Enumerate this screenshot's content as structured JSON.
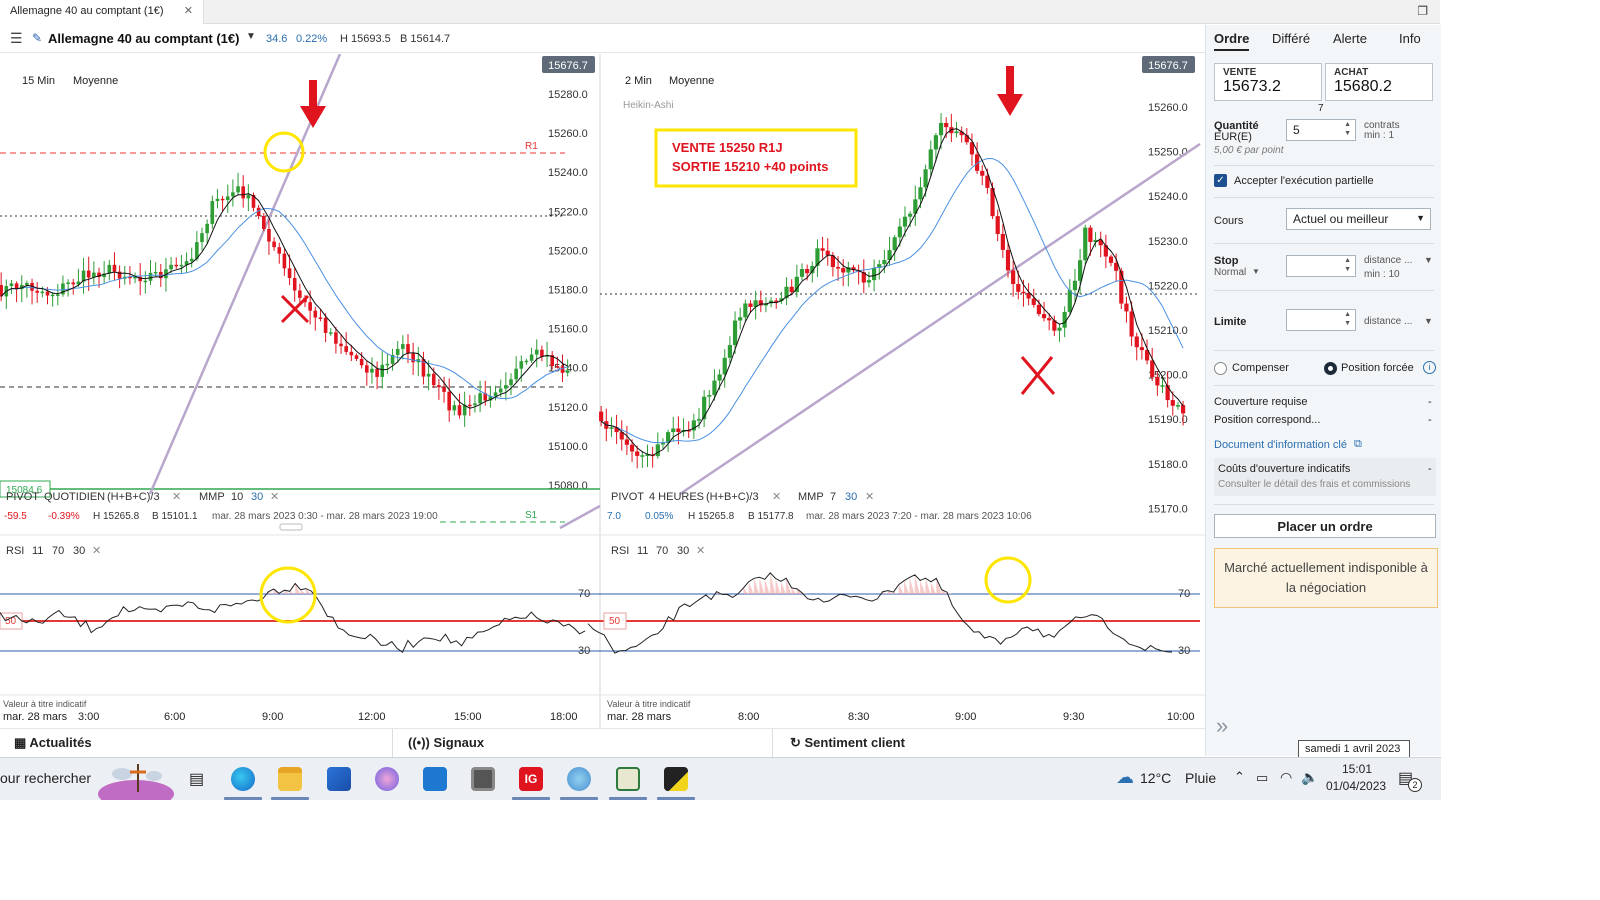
{
  "tab": {
    "title": "Allemagne 40 au comptant (1€)",
    "close": "✕"
  },
  "toolbar": {
    "menu_icon": "hamburger-icon",
    "instrument": "Allemagne 40 au comptant (1€)",
    "change": "34.6",
    "change_pct": "0.22%",
    "high": "H 15693.5",
    "low": "B 15614.7"
  },
  "left_chart": {
    "timeframe": "15 Min",
    "style": "Moyenne",
    "price_badge": "15676.7",
    "yticks": [
      "15280.0",
      "15260.0",
      "15240.0",
      "15220.0",
      "15200.0",
      "15180.0",
      "15160.0",
      "15140.0",
      "15120.0",
      "15100.0",
      "15080.0"
    ],
    "r1": "R1",
    "s1": "S1",
    "green_badge": "15084.6",
    "legend": {
      "pivot": "PIVOT",
      "period": "QUOTIDIEN",
      "formula": "(H+B+C)/3",
      "mmp": "MMP",
      "mmp1": "10",
      "mmp2": "30",
      "close": "✕"
    },
    "info": {
      "chg": "-59.5",
      "pct": "-0.39%",
      "h": "H 15265.8",
      "b": "B 15101.1",
      "range": "mar. 28 mars 2023 0:30 - mar. 28 mars 2023 19:00"
    },
    "rsi": {
      "label": "RSI",
      "p1": "11",
      "p2": "70",
      "p3": "30",
      "level70": "70",
      "level50": "50",
      "level30": "30"
    },
    "disclaimer": "Valeur à titre indicatif",
    "xticks": [
      "mar. 28 mars",
      "3:00",
      "6:00",
      "9:00",
      "12:00",
      "15:00",
      "18:00"
    ]
  },
  "right_chart": {
    "timeframe": "2 Min",
    "style": "Moyenne",
    "subtype": "Heikin-Ashi",
    "price_badge": "15676.7",
    "yticks": [
      "15260.0",
      "15250.0",
      "15240.0",
      "15230.0",
      "15220.0",
      "15210.0",
      "15200.0",
      "15190.0",
      "15180.0",
      "15170.0"
    ],
    "annotation_line1": "VENTE 15250 R1J",
    "annotation_line2": "SORTIE 15210 +40 points",
    "legend": {
      "pivot": "PIVOT",
      "period": "4 HEURES",
      "formula": "(H+B+C)/3",
      "mmp": "MMP",
      "mmp1": "7",
      "mmp2": "30",
      "close": "✕"
    },
    "info": {
      "chg": "7.0",
      "pct": "0.05%",
      "h": "H 15265.8",
      "b": "B 15177.8",
      "range": "mar. 28 mars 2023 7:20 - mar. 28 mars 2023 10:06"
    },
    "rsi": {
      "label": "RSI",
      "p1": "11",
      "p2": "70",
      "p3": "30",
      "level70": "70",
      "level50": "50",
      "level30": "30"
    },
    "disclaimer": "Valeur à titre indicatif",
    "xticks": [
      "mar. 28 mars",
      "8:00",
      "8:30",
      "9:00",
      "9:30",
      "10:00"
    ]
  },
  "bottom_tabs": {
    "news": "Actualités",
    "signals": "Signaux",
    "sentiment": "Sentiment client"
  },
  "order_panel": {
    "tabs": [
      "Ordre",
      "Différé",
      "Alerte",
      "Info"
    ],
    "sell_label": "VENTE",
    "sell_price": "15673.2",
    "buy_label": "ACHAT",
    "buy_price": "15680.2",
    "spread": "7",
    "qty_label": "Quantité",
    "qty_unit": "EUR(E)",
    "qty_value": "5",
    "contracts": "contrats",
    "min1": "min : 1",
    "per_point": "5,00 € par point",
    "partial": "Accepter l'exécution partielle",
    "cours_label": "Cours",
    "cours_value": "Actuel ou meilleur",
    "stop_label": "Stop",
    "stop_type": "Normal",
    "stop_unit": "distance ...",
    "stop_min": "min : 10",
    "limit_label": "Limite",
    "limit_unit": "distance ...",
    "compensate": "Compenser",
    "forced": "Position forcée",
    "coverage": "Couverture requise",
    "coverage_val": "-",
    "position": "Position correspond...",
    "position_val": "-",
    "doc": "Document d'information clé",
    "costs": "Coûts d'ouverture indicatifs",
    "costs_val": "-",
    "costs_detail": "Consulter le détail des frais et commissions",
    "place_order": "Placer un ordre",
    "warning": "Marché actuellement indisponible à la négociation",
    "collapse": "»"
  },
  "taskbar": {
    "search": "our rechercher",
    "weather_temp": "12°C",
    "weather_text": "Pluie",
    "time": "15:01",
    "date": "01/04/2023",
    "notif_count": "2",
    "tooltip_date": "samedi 1 avril 2023"
  },
  "colors": {
    "up": "#2e9d35",
    "down": "#e0141e",
    "ma_fast": "#111111",
    "ma_slow": "#4a90e2",
    "rsi_mid": "#e53935",
    "highlight": "#ffe600"
  }
}
